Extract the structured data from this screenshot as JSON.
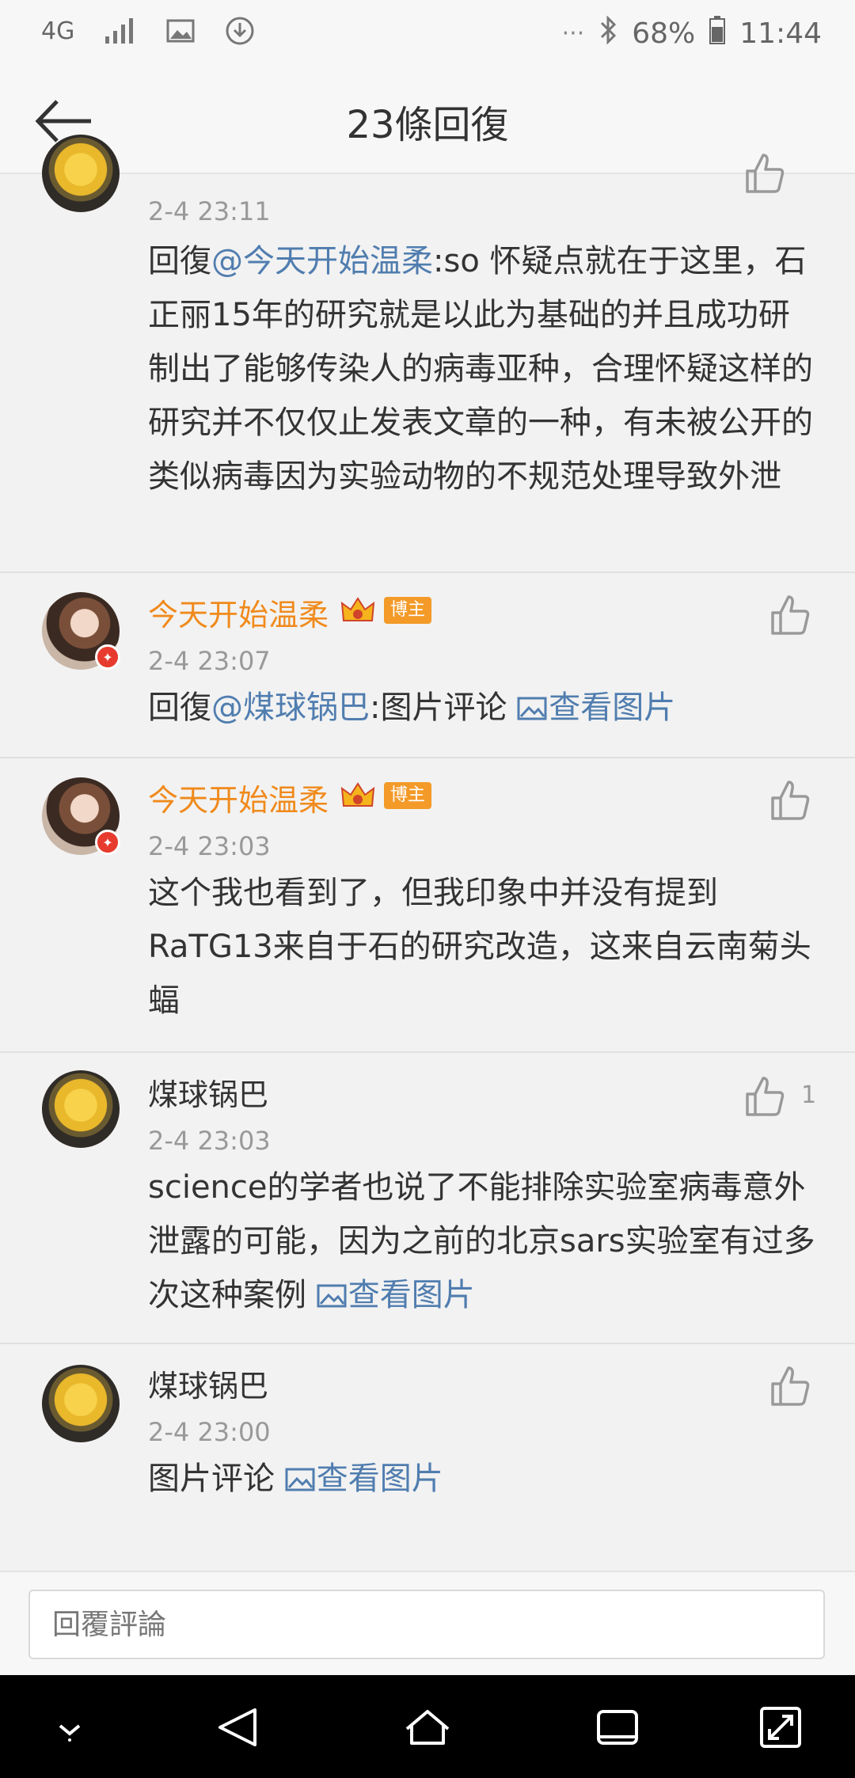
{
  "status_bar": {
    "network": "4G",
    "battery": "68%",
    "time": "11:44",
    "icons": [
      "4g-icon",
      "signal-icon",
      "image-icon",
      "download-icon",
      "more-dots-icon",
      "bluetooth-icon",
      "battery-icon"
    ]
  },
  "header": {
    "title": "23條回復"
  },
  "comments": [
    {
      "name": "",
      "time": "2-4 23:11",
      "prefix": "回復",
      "mention": "@今天开始温柔",
      "text": ":so 怀疑点就在于这里，石正丽15年的研究就是以此为基础的并且成功研制出了能够传染人的病毒亚种，合理怀疑这样的研究并不仅仅止发表文章的一种，有未被公开的类似病毒因为实验动物的不规范处理导致外泄"
    },
    {
      "name": "今天开始温柔",
      "badge": "博主",
      "time": "2-4 23:07",
      "prefix": "回復",
      "mention": "@煤球锅巴",
      "text": ":图片评论 ",
      "view_image": "查看图片"
    },
    {
      "name": "今天开始温柔",
      "badge": "博主",
      "time": "2-4 23:03",
      "text": "这个我也看到了，但我印象中并没有提到RaTG13来自于石的研究改造，这来自云南菊头蝠"
    },
    {
      "name": "煤球锅巴",
      "time": "2-4 23:03",
      "likes": "1",
      "text": "science的学者也说了不能排除实验室病毒意外泄露的可能，因为之前的北京sars实验室有过多次这种案例 ",
      "view_image": "查看图片"
    },
    {
      "name": "煤球锅巴",
      "time": "2-4 23:00",
      "text": "图片评论 ",
      "view_image": "查看图片"
    }
  ],
  "reply_input": {
    "placeholder": "回覆評論"
  },
  "colors": {
    "link": "#507daf",
    "vip_name": "#f08a1c",
    "badge": "#f39a28"
  }
}
